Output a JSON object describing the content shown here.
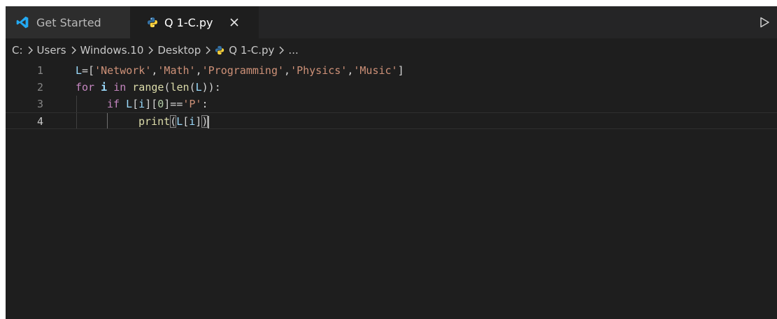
{
  "tabs": [
    {
      "label": "Get Started",
      "icon": "vscode-logo-icon",
      "active": false
    },
    {
      "label": "Q 1-C.py",
      "icon": "python-file-icon",
      "active": true,
      "close_icon": "close-icon"
    }
  ],
  "toolbar": {
    "run_icon": "run-play-icon"
  },
  "breadcrumb": {
    "items": [
      "C:",
      "Users",
      "Windows.10",
      "Desktop",
      "Q 1-C.py",
      "..."
    ],
    "separator_icon": "chevron-right-icon"
  },
  "editor": {
    "language": "python",
    "lines": [
      {
        "number": "1",
        "text": "L=['Network','Math','Programming','Physics','Music']"
      },
      {
        "number": "2",
        "text": "for i in range(len(L)):"
      },
      {
        "number": "3",
        "text": "    if L[i][0]=='P':"
      },
      {
        "number": "4",
        "text": "        print(L[i])"
      }
    ],
    "current_line": "4",
    "tokens": {
      "l1": [
        "L",
        "=[",
        "'Network'",
        ",",
        "'Math'",
        ",",
        "'Programming'",
        ",",
        "'Physics'",
        ",",
        "'Music'",
        "]"
      ],
      "l2": [
        "for",
        " ",
        "i",
        " ",
        "in",
        " ",
        "range",
        "(",
        "len",
        "(",
        "L",
        "))",
        ":"
      ],
      "l3": [
        "if",
        " ",
        "L",
        "[",
        "i",
        "][",
        "0",
        "]==",
        "'P'",
        ":"
      ],
      "l4": [
        "print",
        "(",
        "L",
        "[",
        "i",
        "]",
        ")"
      ]
    }
  },
  "colors": {
    "editor_background": "#1e1e1e",
    "tabbar_background": "#252526",
    "inactive_tab": "#2d2d2d",
    "string": "#ce9178",
    "keyword": "#c586c0",
    "function": "#dcdcaa",
    "variable": "#9cdcfe",
    "number": "#b5cea8",
    "vscode_blue": "#23a9f2",
    "python_blue": "#3572a5",
    "python_yellow": "#ffd43b"
  }
}
